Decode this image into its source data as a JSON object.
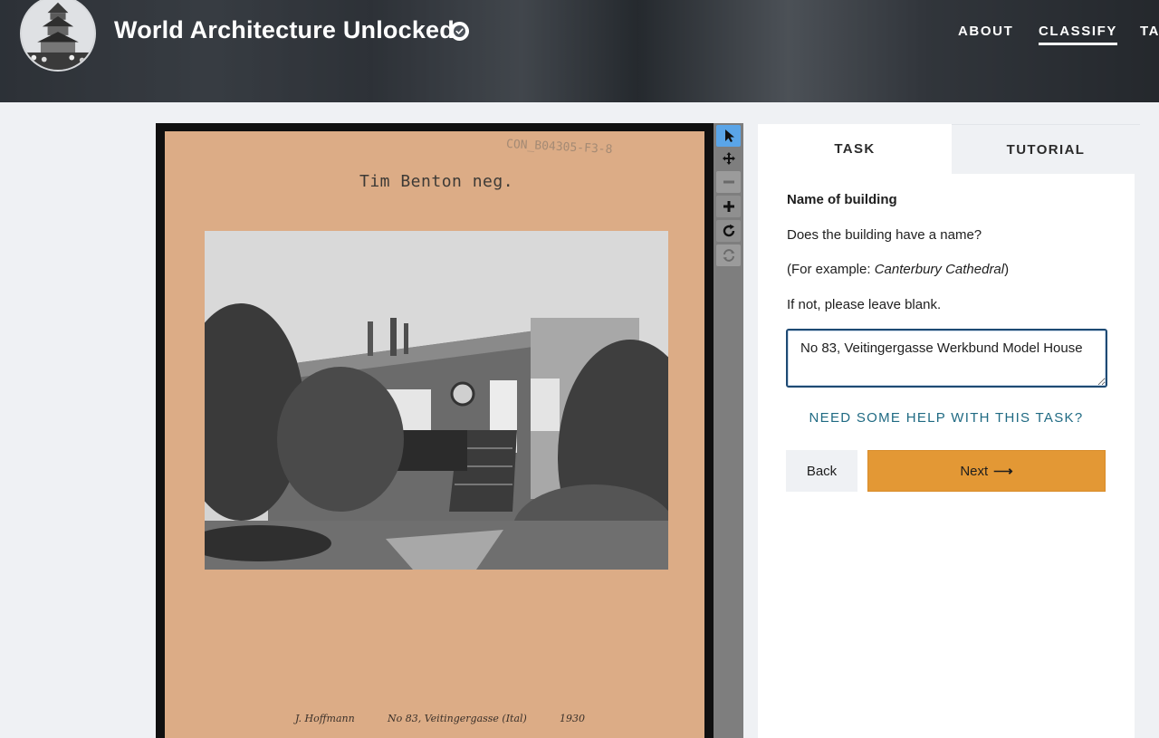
{
  "header": {
    "title": "World Architecture Unlocked",
    "nav": {
      "about": "ABOUT",
      "classify": "CLASSIFY",
      "talk_partial": "TA"
    }
  },
  "viewer": {
    "card_id": "CON_B04305-F3-8",
    "card_caption": "Tim Benton neg.",
    "handwritten": [
      "J. Hoffmann",
      "No 83, Veitingergasse (Ital)",
      "1930"
    ],
    "tools": [
      "pointer-icon",
      "move-icon",
      "zoom-out-icon",
      "zoom-in-icon",
      "rotate-icon",
      "reset-icon"
    ]
  },
  "task": {
    "tabs": {
      "task": "TASK",
      "tutorial": "TUTORIAL"
    },
    "question_title": "Name of building",
    "question_line1": "Does the building have a name?",
    "example_prefix": "(For example: ",
    "example_name": "Canterbury Cathedral",
    "example_suffix": ")",
    "question_line3": "If not, please leave blank.",
    "answer_value": "No 83, Veitingergasse Werkbund Model House",
    "help_link": "NEED SOME HELP WITH THIS TASK?",
    "back_label": "Back",
    "next_label": "Next",
    "next_arrow": "⟶"
  },
  "colors": {
    "accent_orange": "#e39835",
    "link_teal": "#1f6a83",
    "active_tool": "#5aa5e8",
    "card_tan": "#dcac86"
  }
}
